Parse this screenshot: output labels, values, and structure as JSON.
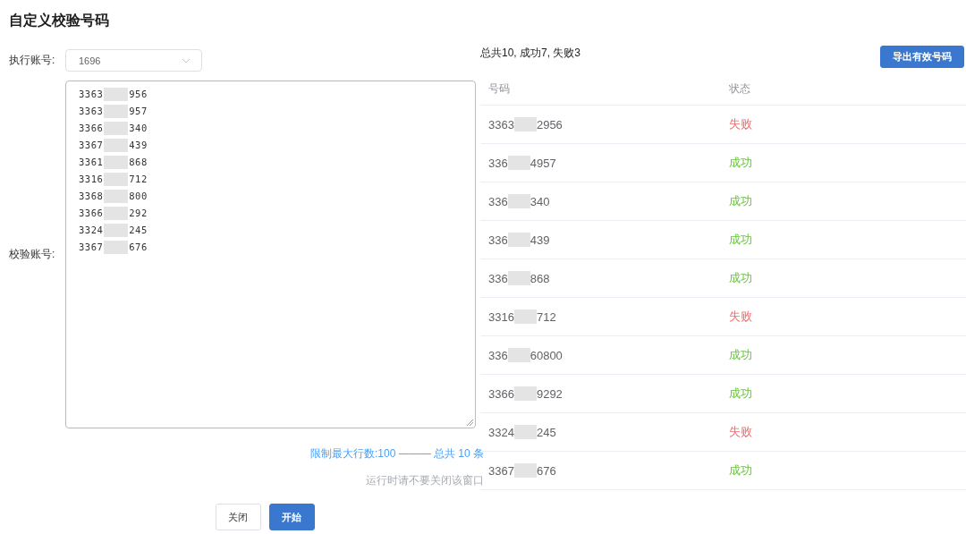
{
  "title": "自定义校验号码",
  "exec_account": {
    "label": "执行账号:",
    "value": "1696"
  },
  "check_accounts": {
    "label": "校验账号:",
    "lines": [
      {
        "prefix": "3363",
        "suffix": "956"
      },
      {
        "prefix": "3363",
        "suffix": "957"
      },
      {
        "prefix": "3366",
        "suffix": "340"
      },
      {
        "prefix": "3367",
        "suffix": "439"
      },
      {
        "prefix": "3361",
        "suffix": "868"
      },
      {
        "prefix": "3316",
        "suffix": "712"
      },
      {
        "prefix": "3368",
        "suffix": "800"
      },
      {
        "prefix": "3366",
        "suffix": "292"
      },
      {
        "prefix": "3324",
        "suffix": "245"
      },
      {
        "prefix": "3367",
        "suffix": "676"
      }
    ]
  },
  "limit_hint": "限制最大行数:100 ——— 总共 10 条",
  "run_hint": "运行时请不要关闭该窗口",
  "buttons": [
    {
      "label": "关闭",
      "kind": "default"
    },
    {
      "label": "开始",
      "kind": "primary"
    }
  ],
  "summary": "总共10, 成功7, 失败3",
  "export_button": "导出有效号码",
  "table": {
    "columns": [
      "号码",
      "状态"
    ],
    "rows": [
      {
        "prefix": "3363",
        "suffix": "2956",
        "status": "失败",
        "kind": "fail"
      },
      {
        "prefix": "336",
        "suffix": "4957",
        "status": "成功",
        "kind": "success"
      },
      {
        "prefix": "336",
        "suffix": "340",
        "status": "成功",
        "kind": "success"
      },
      {
        "prefix": "336",
        "suffix": "439",
        "status": "成功",
        "kind": "success"
      },
      {
        "prefix": "336",
        "suffix": "868",
        "status": "成功",
        "kind": "success"
      },
      {
        "prefix": "3316",
        "suffix": "712",
        "status": "失败",
        "kind": "fail"
      },
      {
        "prefix": "336",
        "suffix": "60800",
        "status": "成功",
        "kind": "success"
      },
      {
        "prefix": "3366",
        "suffix": "9292",
        "status": "成功",
        "kind": "success"
      },
      {
        "prefix": "3324",
        "suffix": "245",
        "status": "失败",
        "kind": "fail"
      },
      {
        "prefix": "3367",
        "suffix": "676",
        "status": "成功",
        "kind": "success"
      }
    ]
  }
}
